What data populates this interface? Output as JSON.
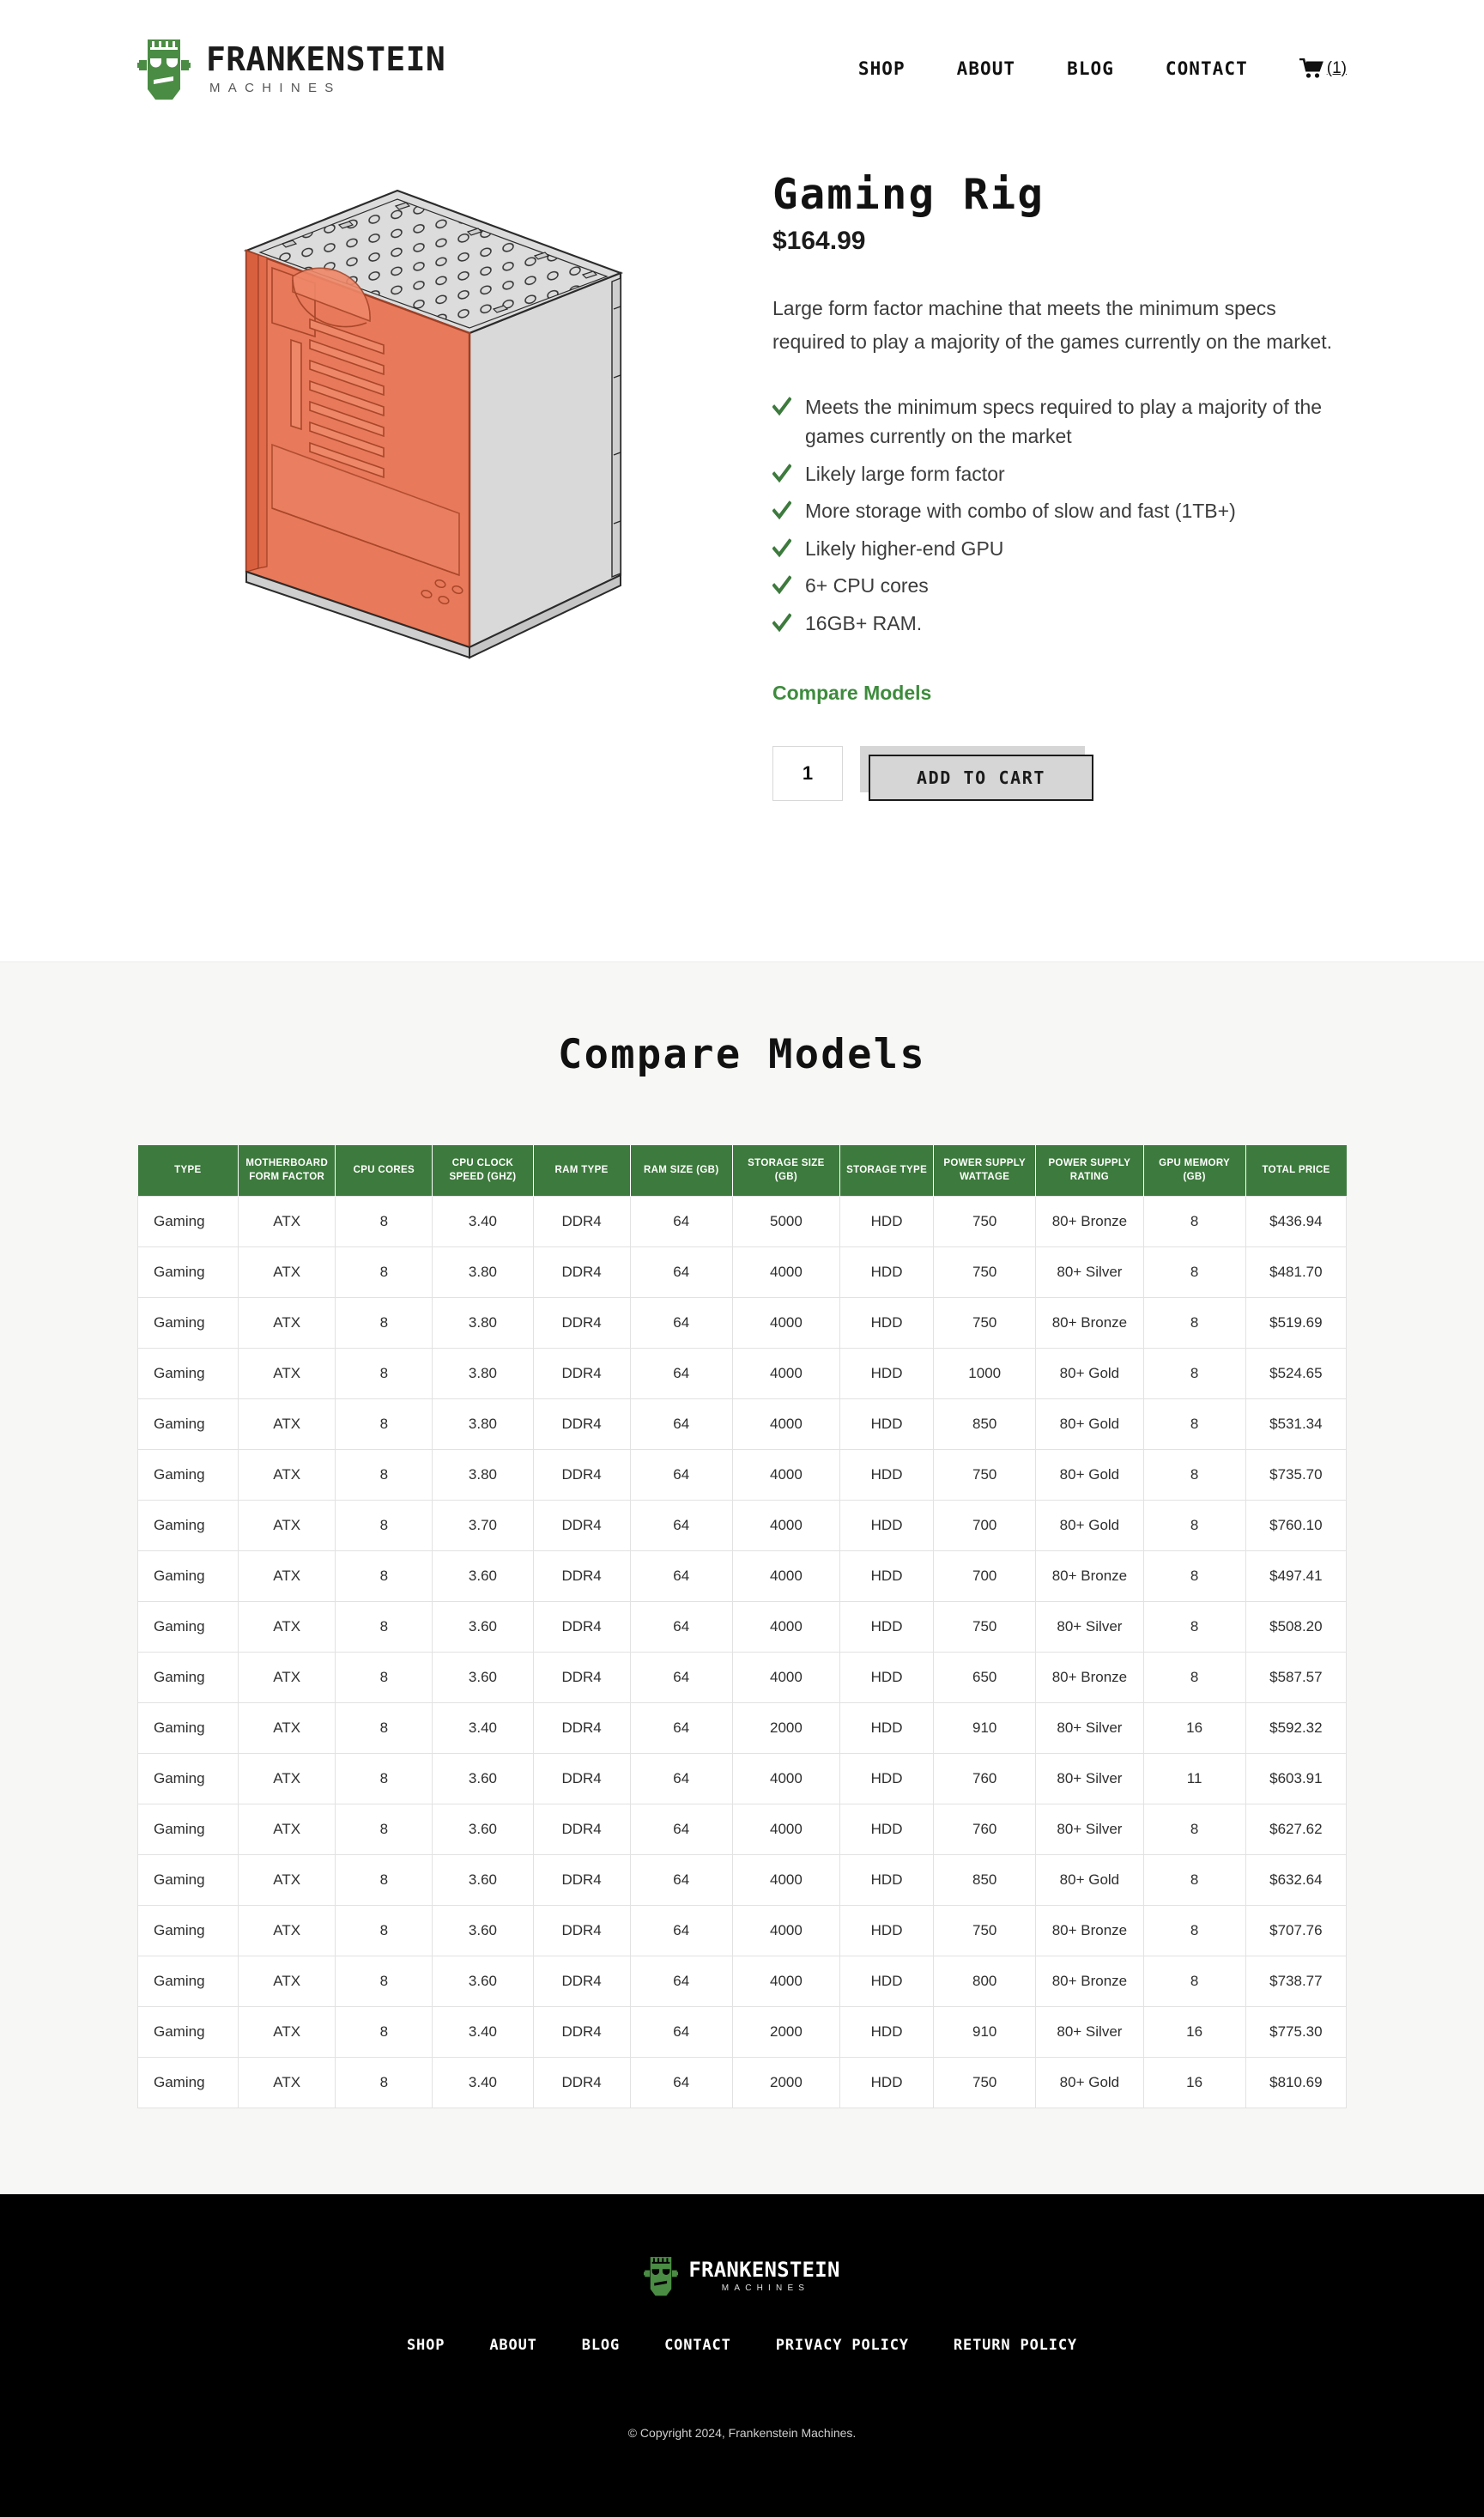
{
  "brand": {
    "name": "FRANKENSTEIN",
    "tagline": "MACHINES",
    "logo_color": "#4a8c43"
  },
  "header": {
    "nav": [
      {
        "label": "SHOP"
      },
      {
        "label": "ABOUT"
      },
      {
        "label": "BLOG"
      },
      {
        "label": "CONTACT"
      }
    ],
    "cart": {
      "icon": "shopping-cart-icon",
      "count": "(1)"
    }
  },
  "product": {
    "image_alt": "isometric-pc-case-illustration",
    "case_colors": {
      "panel": "#e8795a",
      "metal": "#d8d8d8",
      "outline": "#2b2b2b"
    },
    "title": "Gaming Rig",
    "price": "$164.99",
    "description": "Large form factor machine that meets the minimum specs required to play a majority of the games currently on the market.",
    "features": [
      "Meets the minimum specs required to play a majority of the games currently on the market",
      "Likely large form factor",
      "More storage with combo of slow and fast (1TB+)",
      "Likely higher-end GPU",
      "6+ CPU cores",
      "16GB+ RAM."
    ],
    "compare_link": "Compare Models",
    "quantity": "1",
    "add_to_cart_label": "ADD TO CART",
    "accent_color": "#3d8b3d"
  },
  "compare": {
    "heading": "Compare Models",
    "header_color": "#3d7a3d",
    "columns": [
      "TYPE",
      "MOTHERBOARD FORM FACTOR",
      "CPU CORES",
      "CPU CLOCK SPEED (GHZ)",
      "RAM TYPE",
      "RAM SIZE (GB)",
      "STORAGE SIZE (GB)",
      "STORAGE TYPE",
      "POWER SUPPLY WATTAGE",
      "POWER SUPPLY RATING",
      "GPU MEMORY (GB)",
      "TOTAL PRICE"
    ],
    "rows": [
      [
        "Gaming",
        "ATX",
        "8",
        "3.40",
        "DDR4",
        "64",
        "5000",
        "HDD",
        "750",
        "80+ Bronze",
        "8",
        "$436.94"
      ],
      [
        "Gaming",
        "ATX",
        "8",
        "3.80",
        "DDR4",
        "64",
        "4000",
        "HDD",
        "750",
        "80+ Silver",
        "8",
        "$481.70"
      ],
      [
        "Gaming",
        "ATX",
        "8",
        "3.80",
        "DDR4",
        "64",
        "4000",
        "HDD",
        "750",
        "80+ Bronze",
        "8",
        "$519.69"
      ],
      [
        "Gaming",
        "ATX",
        "8",
        "3.80",
        "DDR4",
        "64",
        "4000",
        "HDD",
        "1000",
        "80+ Gold",
        "8",
        "$524.65"
      ],
      [
        "Gaming",
        "ATX",
        "8",
        "3.80",
        "DDR4",
        "64",
        "4000",
        "HDD",
        "850",
        "80+ Gold",
        "8",
        "$531.34"
      ],
      [
        "Gaming",
        "ATX",
        "8",
        "3.80",
        "DDR4",
        "64",
        "4000",
        "HDD",
        "750",
        "80+ Gold",
        "8",
        "$735.70"
      ],
      [
        "Gaming",
        "ATX",
        "8",
        "3.70",
        "DDR4",
        "64",
        "4000",
        "HDD",
        "700",
        "80+ Gold",
        "8",
        "$760.10"
      ],
      [
        "Gaming",
        "ATX",
        "8",
        "3.60",
        "DDR4",
        "64",
        "4000",
        "HDD",
        "700",
        "80+ Bronze",
        "8",
        "$497.41"
      ],
      [
        "Gaming",
        "ATX",
        "8",
        "3.60",
        "DDR4",
        "64",
        "4000",
        "HDD",
        "750",
        "80+ Silver",
        "8",
        "$508.20"
      ],
      [
        "Gaming",
        "ATX",
        "8",
        "3.60",
        "DDR4",
        "64",
        "4000",
        "HDD",
        "650",
        "80+ Bronze",
        "8",
        "$587.57"
      ],
      [
        "Gaming",
        "ATX",
        "8",
        "3.40",
        "DDR4",
        "64",
        "2000",
        "HDD",
        "910",
        "80+ Silver",
        "16",
        "$592.32"
      ],
      [
        "Gaming",
        "ATX",
        "8",
        "3.60",
        "DDR4",
        "64",
        "4000",
        "HDD",
        "760",
        "80+ Silver",
        "11",
        "$603.91"
      ],
      [
        "Gaming",
        "ATX",
        "8",
        "3.60",
        "DDR4",
        "64",
        "4000",
        "HDD",
        "760",
        "80+ Silver",
        "8",
        "$627.62"
      ],
      [
        "Gaming",
        "ATX",
        "8",
        "3.60",
        "DDR4",
        "64",
        "4000",
        "HDD",
        "850",
        "80+ Gold",
        "8",
        "$632.64"
      ],
      [
        "Gaming",
        "ATX",
        "8",
        "3.60",
        "DDR4",
        "64",
        "4000",
        "HDD",
        "750",
        "80+ Bronze",
        "8",
        "$707.76"
      ],
      [
        "Gaming",
        "ATX",
        "8",
        "3.60",
        "DDR4",
        "64",
        "4000",
        "HDD",
        "800",
        "80+ Bronze",
        "8",
        "$738.77"
      ],
      [
        "Gaming",
        "ATX",
        "8",
        "3.40",
        "DDR4",
        "64",
        "2000",
        "HDD",
        "910",
        "80+ Silver",
        "16",
        "$775.30"
      ],
      [
        "Gaming",
        "ATX",
        "8",
        "3.40",
        "DDR4",
        "64",
        "2000",
        "HDD",
        "750",
        "80+ Gold",
        "16",
        "$810.69"
      ]
    ]
  },
  "footer": {
    "nav": [
      {
        "label": "SHOP"
      },
      {
        "label": "ABOUT"
      },
      {
        "label": "BLOG"
      },
      {
        "label": "CONTACT"
      },
      {
        "label": "PRIVACY POLICY"
      },
      {
        "label": "RETURN POLICY"
      }
    ],
    "copyright": "© Copyright 2024, Frankenstein Machines."
  }
}
